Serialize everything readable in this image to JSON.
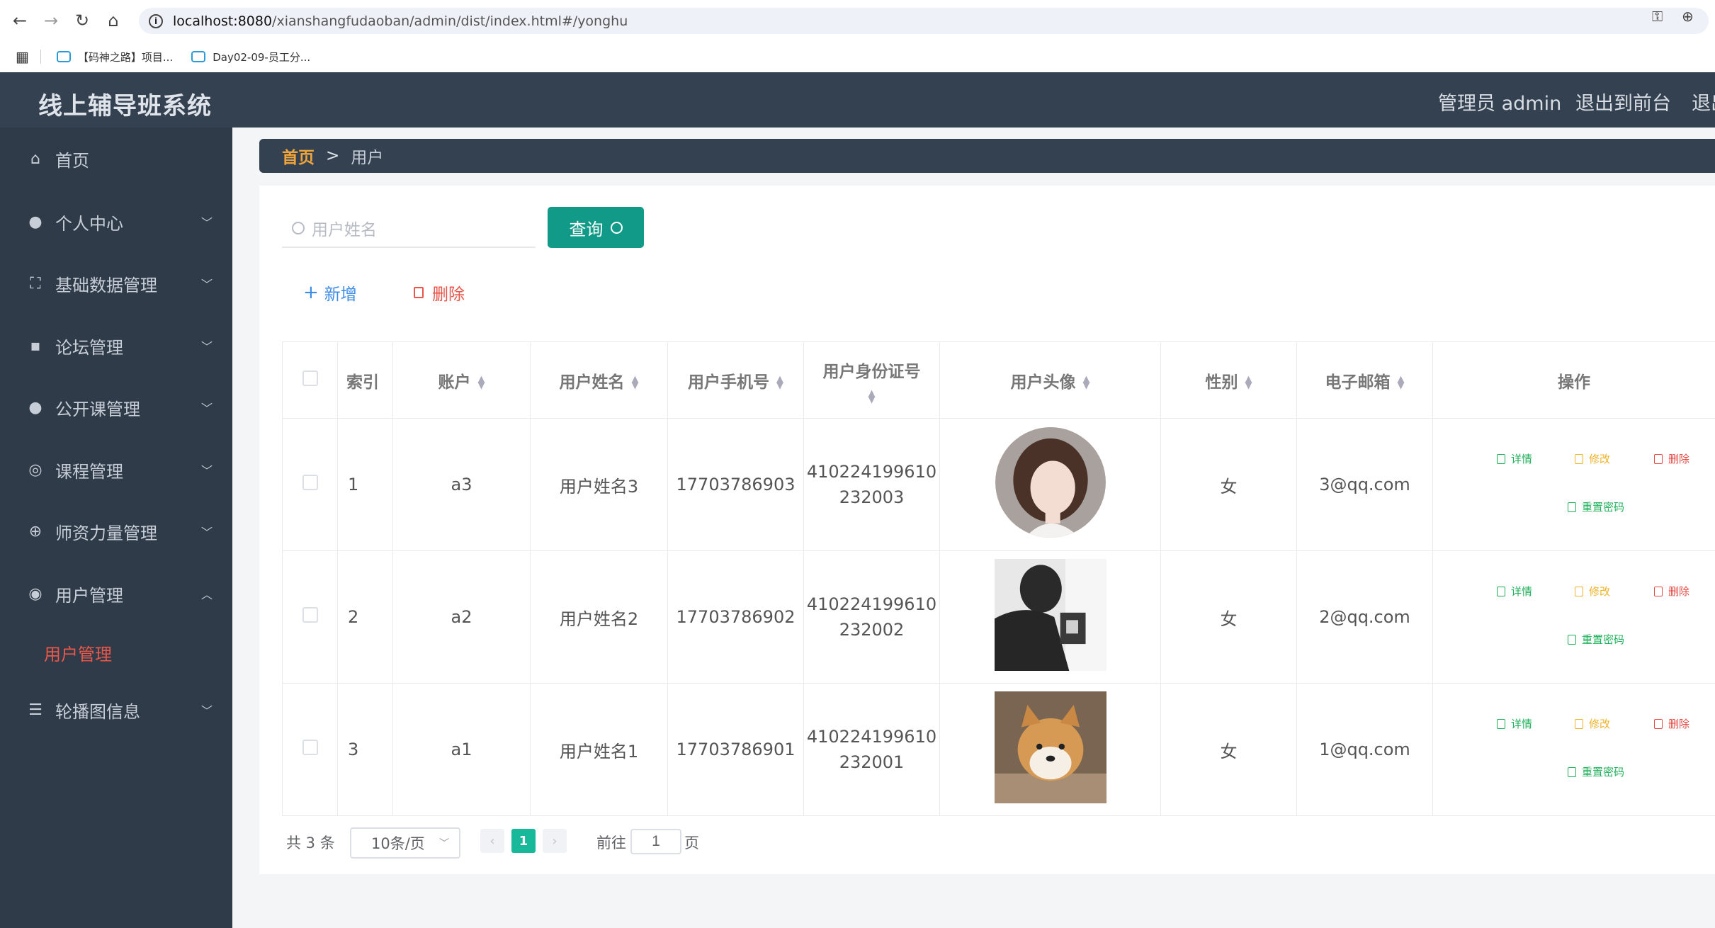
{
  "browser": {
    "url_host": "localhost:8080",
    "url_path": "/xianshangfudaoban/admin/dist/index.html#/yonghu",
    "bookmarks": [
      "【码神之路】项目...",
      "Day02-09-员工分..."
    ]
  },
  "header": {
    "title": "线上辅导班系统",
    "admin_label": "管理员 admin",
    "to_front": "退出到前台",
    "logout": "退出"
  },
  "sidebar": {
    "items": [
      {
        "label": "首页",
        "icon": "home-icon"
      },
      {
        "label": "个人中心",
        "icon": "user-icon"
      },
      {
        "label": "基础数据管理",
        "icon": "frame-icon"
      },
      {
        "label": "论坛管理",
        "icon": "chat-icon"
      },
      {
        "label": "公开课管理",
        "icon": "user-icon"
      },
      {
        "label": "课程管理",
        "icon": "compass-icon"
      },
      {
        "label": "师资力量管理",
        "icon": "globe-icon"
      },
      {
        "label": "用户管理",
        "icon": "target-icon"
      },
      {
        "label": "轮播图信息",
        "icon": "list-icon"
      }
    ],
    "active_sub": "用户管理",
    "active_color": "#e9574a"
  },
  "breadcrumb": {
    "home": "首页",
    "sep": ">",
    "current": "用户"
  },
  "search": {
    "placeholder": "用户姓名",
    "button": "查询"
  },
  "actions": {
    "add": "新增",
    "delete": "删除"
  },
  "table": {
    "headers": [
      "索引",
      "账户",
      "用户姓名",
      "用户手机号",
      "用户身份证号",
      "用户头像",
      "性别",
      "电子邮箱",
      "操作"
    ],
    "rows": [
      {
        "index": "1",
        "account": "a3",
        "name": "用户姓名3",
        "phone": "17703786903",
        "id1": "410224199610",
        "id2": "232003",
        "gender": "女",
        "email": "3@qq.com"
      },
      {
        "index": "2",
        "account": "a2",
        "name": "用户姓名2",
        "phone": "17703786902",
        "id1": "410224199610",
        "id2": "232002",
        "gender": "女",
        "email": "2@qq.com"
      },
      {
        "index": "3",
        "account": "a1",
        "name": "用户姓名1",
        "phone": "17703786901",
        "id1": "410224199610",
        "id2": "232001",
        "gender": "女",
        "email": "1@qq.com"
      }
    ],
    "ops": {
      "detail": "详情",
      "edit": "修改",
      "delete": "删除",
      "reset": "重置密码"
    }
  },
  "pagination": {
    "total": "共 3 条",
    "page_size": "10条/页",
    "current": "1",
    "goto": "前往",
    "goto_value": "1",
    "page_suffix": "页"
  },
  "colors": {
    "header_bg": "#344150",
    "sidebar_bg": "#2f3b48",
    "primary": "#129a88",
    "page_active": "#18b99a"
  }
}
